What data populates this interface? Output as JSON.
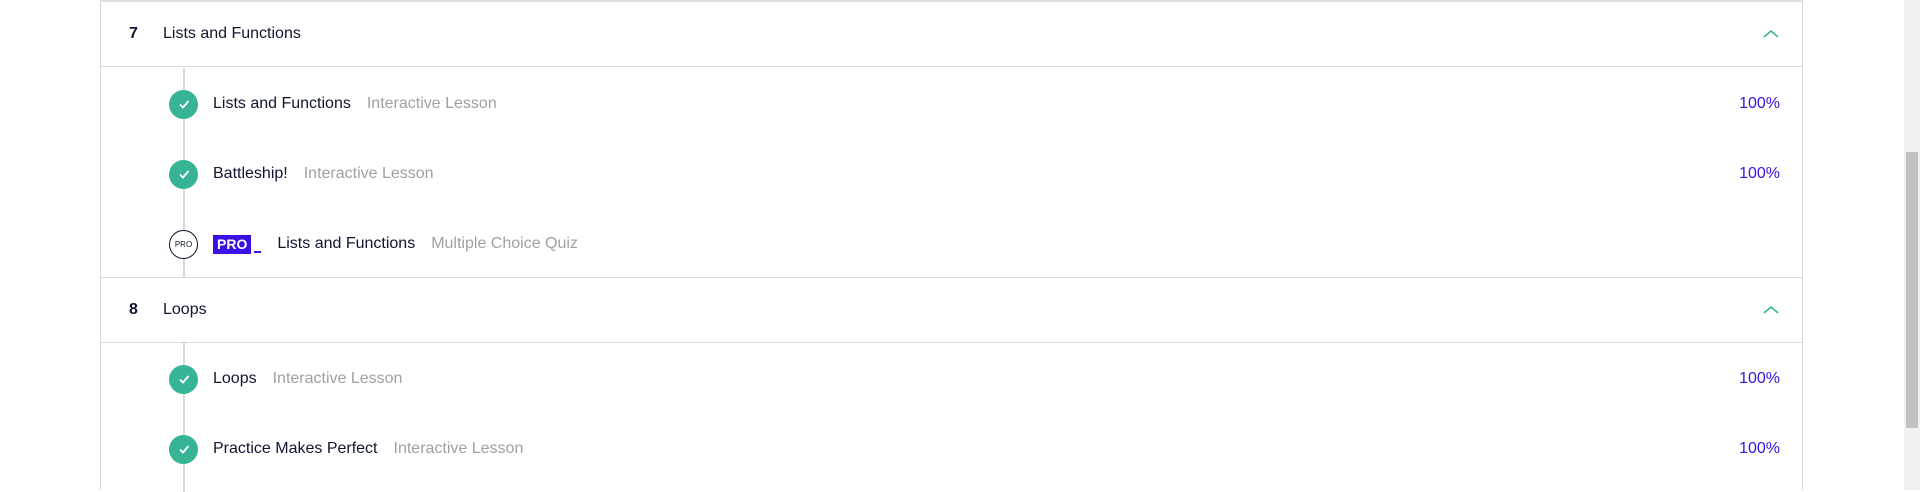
{
  "sections": [
    {
      "number": "7",
      "title": "Lists and Functions",
      "items": [
        {
          "title": "Lists and Functions",
          "type": "Interactive Lesson",
          "progress": "100%",
          "status": "completed"
        },
        {
          "title": "Battleship!",
          "type": "Interactive Lesson",
          "progress": "100%",
          "status": "completed"
        },
        {
          "title": "Lists and Functions",
          "type": "Multiple Choice Quiz",
          "progress": "",
          "status": "pro",
          "badge": "PRO",
          "status_label": "PRO"
        }
      ]
    },
    {
      "number": "8",
      "title": "Loops",
      "items": [
        {
          "title": "Loops",
          "type": "Interactive Lesson",
          "progress": "100%",
          "status": "completed"
        },
        {
          "title": "Practice Makes Perfect",
          "type": "Interactive Lesson",
          "progress": "100%",
          "status": "completed"
        }
      ]
    }
  ],
  "icons": {
    "collapse": "chevron-up-icon",
    "completed": "check-circle-icon",
    "locked": "pro-circle-icon"
  },
  "colors": {
    "accent": "#3a10e5",
    "completed": "#37b495",
    "chevron": "#37b495"
  }
}
